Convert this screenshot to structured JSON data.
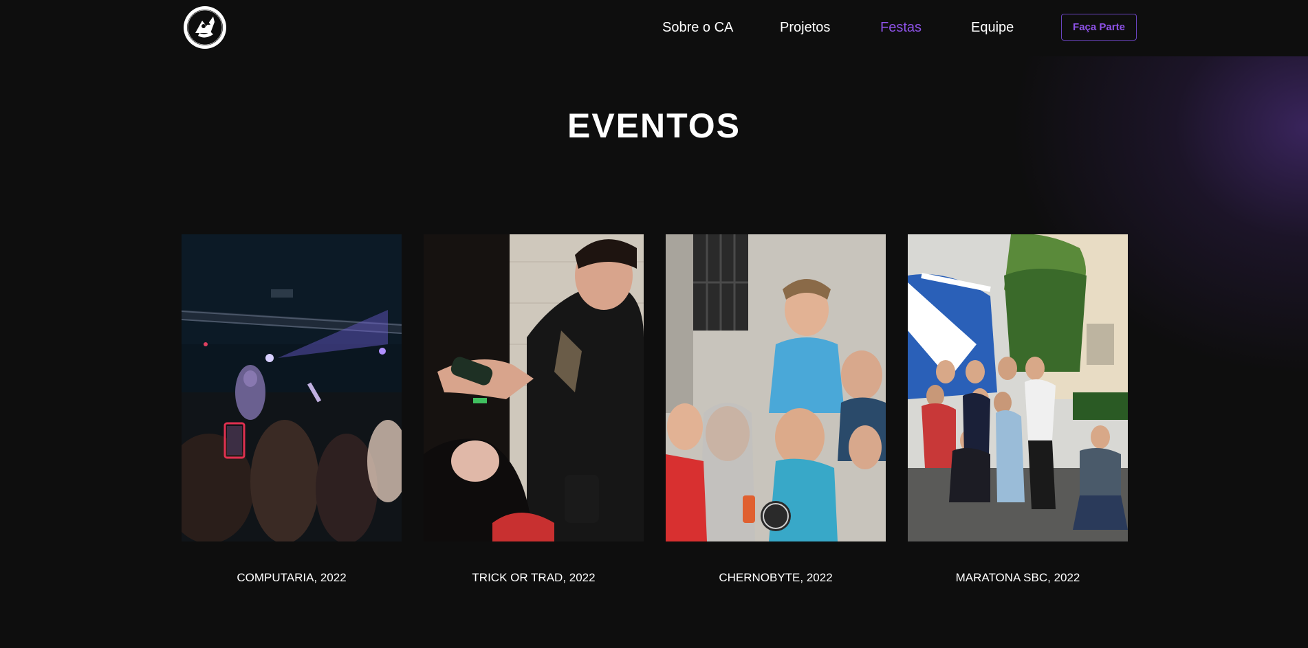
{
  "header": {
    "logo_icon": "ca-mascot-logo-icon",
    "nav": [
      {
        "label": "Sobre o CA",
        "active": false
      },
      {
        "label": "Projetos",
        "active": false
      },
      {
        "label": "Festas",
        "active": true
      },
      {
        "label": "Equipe",
        "active": false
      }
    ],
    "cta_label": "Faça Parte"
  },
  "main": {
    "title": "EVENTOS",
    "events": [
      {
        "caption": "COMPUTARIA, 2022"
      },
      {
        "caption": "TRICK OR TRAD, 2022"
      },
      {
        "caption": "CHERNOBYTE, 2022"
      },
      {
        "caption": "MARATONA SBC, 2022"
      }
    ]
  },
  "colors": {
    "background": "#0e0e0e",
    "accent": "#8e52e8",
    "button_border": "#6a44c0",
    "glow": "#54328c"
  }
}
